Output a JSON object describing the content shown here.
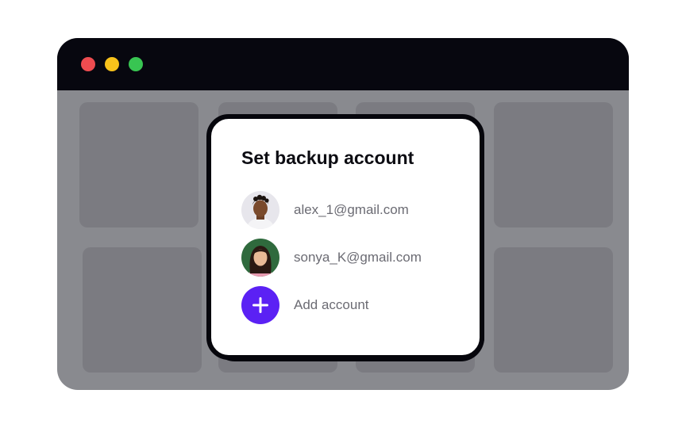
{
  "window": {
    "controls": [
      {
        "name": "close",
        "color": "#ee4c50"
      },
      {
        "name": "minimize",
        "color": "#f8c21b"
      },
      {
        "name": "maximize",
        "color": "#38c552"
      }
    ],
    "titlebar_color": "#07070f",
    "background_color": "#898a8f",
    "tile_color": "#7b7b81"
  },
  "dialog": {
    "title": "Set backup account",
    "accounts": [
      {
        "email": "alex_1@gmail.com",
        "avatar_icon": "user-photo-icon"
      },
      {
        "email": "sonya_K@gmail.com",
        "avatar_icon": "user-photo-icon"
      }
    ],
    "add_account_label": "Add account",
    "add_icon": "plus-icon",
    "accent_color": "#5b21f4"
  }
}
